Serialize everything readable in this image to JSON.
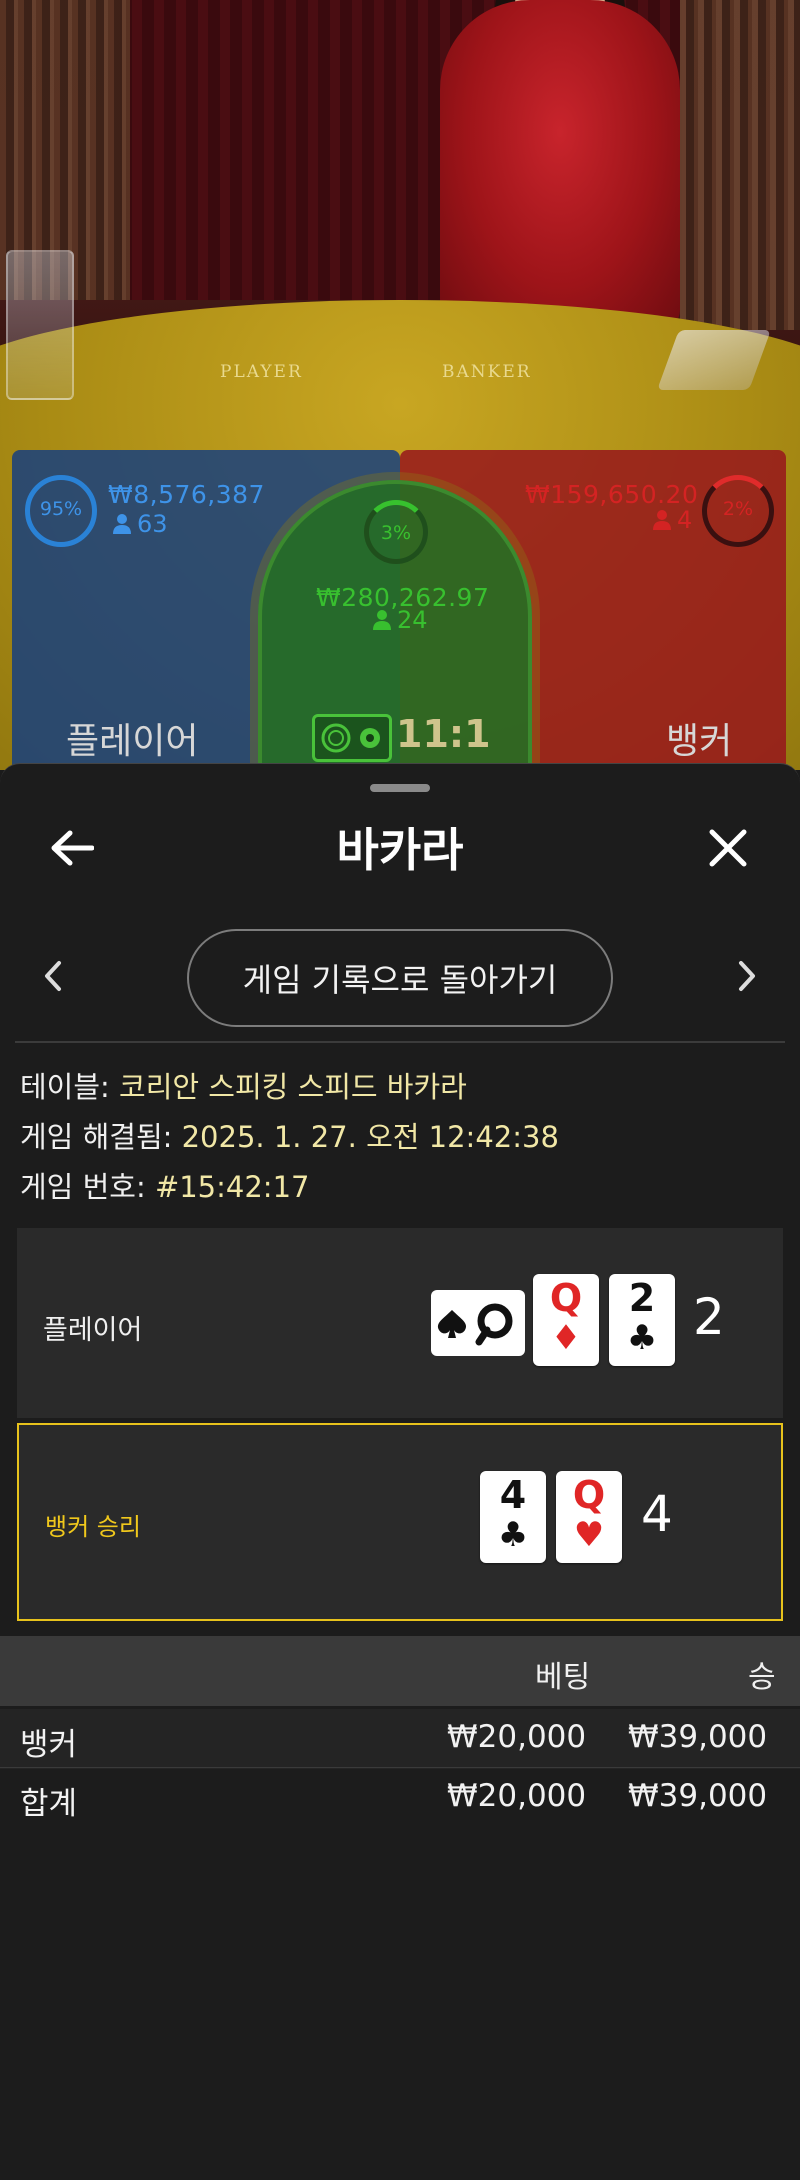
{
  "live_table": {
    "felt_labels": {
      "player": "PLAYER",
      "banker": "BANKER"
    },
    "player": {
      "percent": "95%",
      "amount": "₩8,576,387",
      "count": "63",
      "label": "플레이어"
    },
    "tie": {
      "percent": "3%",
      "amount": "₩280,262.97",
      "count": "24",
      "payout": "11:1"
    },
    "banker": {
      "percent": "2%",
      "amount": "₩159,650.20",
      "count": "4",
      "label": "뱅커"
    },
    "colors": {
      "player": "#2a82d6",
      "banker": "#d42323",
      "tie": "#38c02f"
    }
  },
  "sheet": {
    "title": "바카라",
    "back_to_history": "게임 기록으로 돌아가기",
    "info": {
      "table_label": "테이블: ",
      "table_value": "코리안 스피킹 스피드 바카라",
      "resolved_label": "게임 해결됨: ",
      "resolved_value": "2025. 1. 27. 오전 12:42:38",
      "game_no_label": "게임 번호: ",
      "game_no_value": "#15:42:17"
    },
    "player_hand": {
      "label": "플레이어",
      "score": "2",
      "cards": [
        {
          "rank": "Q",
          "suit": "♦",
          "color": "red"
        },
        {
          "rank": "2",
          "suit": "♣",
          "color": "black"
        }
      ],
      "sideways_card": {
        "rank": "Q",
        "suit": "♠"
      }
    },
    "banker_hand": {
      "label": "뱅커 승리",
      "score": "4",
      "cards": [
        {
          "rank": "4",
          "suit": "♣",
          "color": "black"
        },
        {
          "rank": "Q",
          "suit": "♥",
          "color": "red"
        }
      ]
    },
    "table": {
      "headers": {
        "bet": "베팅",
        "win": "승"
      },
      "rows": [
        {
          "name": "뱅커",
          "bet": "₩20,000",
          "win": "₩39,000"
        },
        {
          "name": "합계",
          "bet": "₩20,000",
          "win": "₩39,000"
        }
      ]
    }
  }
}
